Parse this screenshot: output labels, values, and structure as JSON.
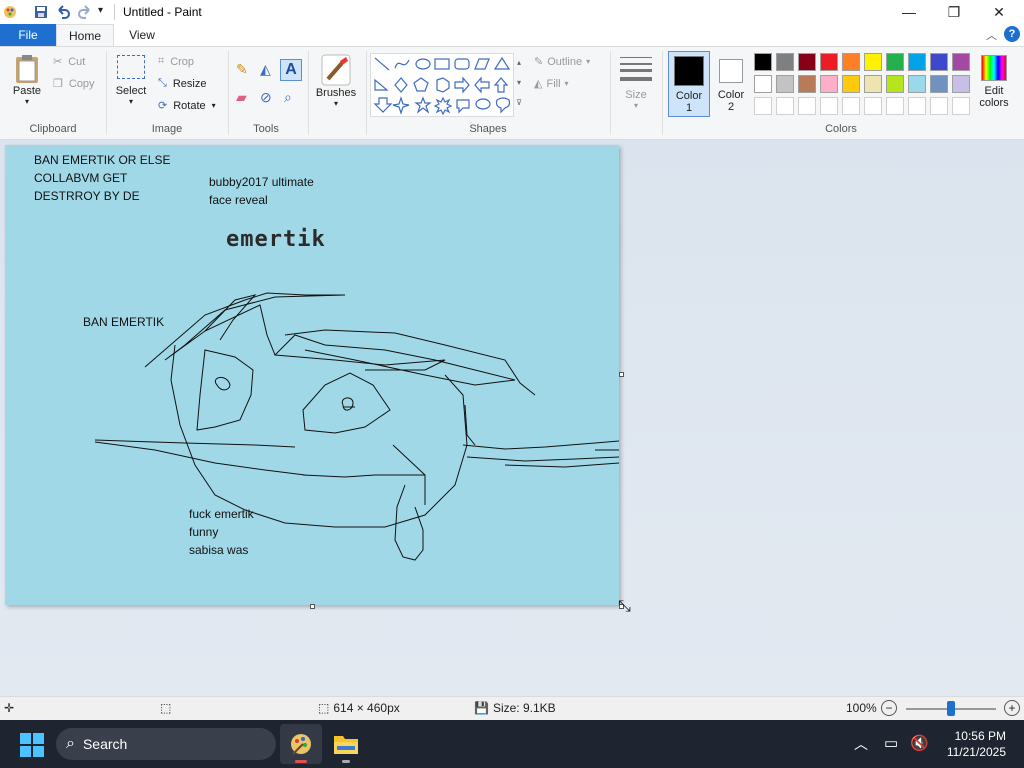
{
  "window": {
    "title": "Untitled - Paint",
    "minimize": "—",
    "maximize": "❐",
    "close": "✕"
  },
  "tabs": {
    "file": "File",
    "home": "Home",
    "view": "View"
  },
  "ribbon": {
    "clipboard": {
      "label": "Clipboard",
      "paste": "Paste",
      "cut": "Cut",
      "copy": "Copy"
    },
    "image": {
      "label": "Image",
      "select": "Select",
      "crop": "Crop",
      "resize": "Resize",
      "rotate": "Rotate"
    },
    "tools": {
      "label": "Tools"
    },
    "brushes": {
      "label": "Brushes"
    },
    "shapes": {
      "label": "Shapes",
      "outline": "Outline",
      "fill": "Fill"
    },
    "size": {
      "label": "Size"
    },
    "color1": {
      "label": "Color",
      "sub": "1",
      "value": "#000000"
    },
    "color2": {
      "label": "Color",
      "sub": "2",
      "value": "#ffffff"
    },
    "colors": {
      "label": "Colors",
      "edit": "Edit",
      "edit2": "colors"
    },
    "palette_row1": [
      "#000000",
      "#7f7f7f",
      "#880015",
      "#ed1c24",
      "#ff7f27",
      "#fff200",
      "#22b14c",
      "#00a2e8",
      "#3f48cc",
      "#a349a4"
    ],
    "palette_row2": [
      "#ffffff",
      "#c3c3c3",
      "#b97a57",
      "#ffaec9",
      "#ffc90e",
      "#efe4b0",
      "#b5e61d",
      "#99d9ea",
      "#7092be",
      "#c8bfe7"
    ]
  },
  "canvas": {
    "background": "#a0d8e8",
    "text_blocks": {
      "block1": "BAN EMERTIK OR ELSE\nCOLLABVM GET\nDESTRROY BY DE",
      "block2": "bubby2017 ultimate\nface reveal",
      "block3": "emertik",
      "block4": "BAN EMERTIK",
      "block5": "fuck emertik\nfunny\nsabisa was"
    }
  },
  "status": {
    "dimensions": "614 × 460px",
    "size": "Size: 9.1KB",
    "zoom": "100%",
    "zoom_level_fraction": 0.5
  },
  "taskbar": {
    "search": "Search",
    "time": "10:56 PM",
    "date": "11/21/2025"
  }
}
